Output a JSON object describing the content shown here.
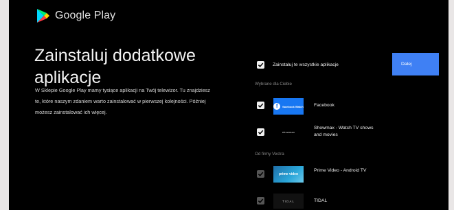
{
  "brand": {
    "logo_text": "Google Play"
  },
  "page": {
    "title": "Zainstaluj dodatkowe aplikacje",
    "description": "W Sklepie Google Play mamy tysiące aplikacji na Twój telewizor. Tu znajdziesz te, które naszym zdaniem warto zainstalować w pierwszej kolejności. Później możesz zainstalować ich więcej."
  },
  "install_all": {
    "label": "Zainstaluj te wszystkie aplikacje",
    "checked": true
  },
  "next_button": {
    "label": "Dalej"
  },
  "sections": [
    {
      "heading": "Wybrane dla Ciebie",
      "apps": [
        {
          "name": "Facebook",
          "thumb_text": "facebook Watch",
          "checked": true,
          "enabled": true
        },
        {
          "name": "Showmax - Watch TV shows and movies",
          "thumb_text": "showmax",
          "checked": true,
          "enabled": true
        }
      ]
    },
    {
      "heading": "Od firmy Vectra",
      "apps": [
        {
          "name": "Prime Video - Android TV",
          "thumb_text": "prime video",
          "checked": true,
          "enabled": false
        },
        {
          "name": "TIDAL",
          "thumb_text": "TIDAL",
          "checked": true,
          "enabled": false
        }
      ]
    }
  ],
  "colors": {
    "background": "#000000",
    "accent": "#3f80f4",
    "checkbox": "#f0f0f0",
    "checkbox_disabled": "#555555"
  }
}
